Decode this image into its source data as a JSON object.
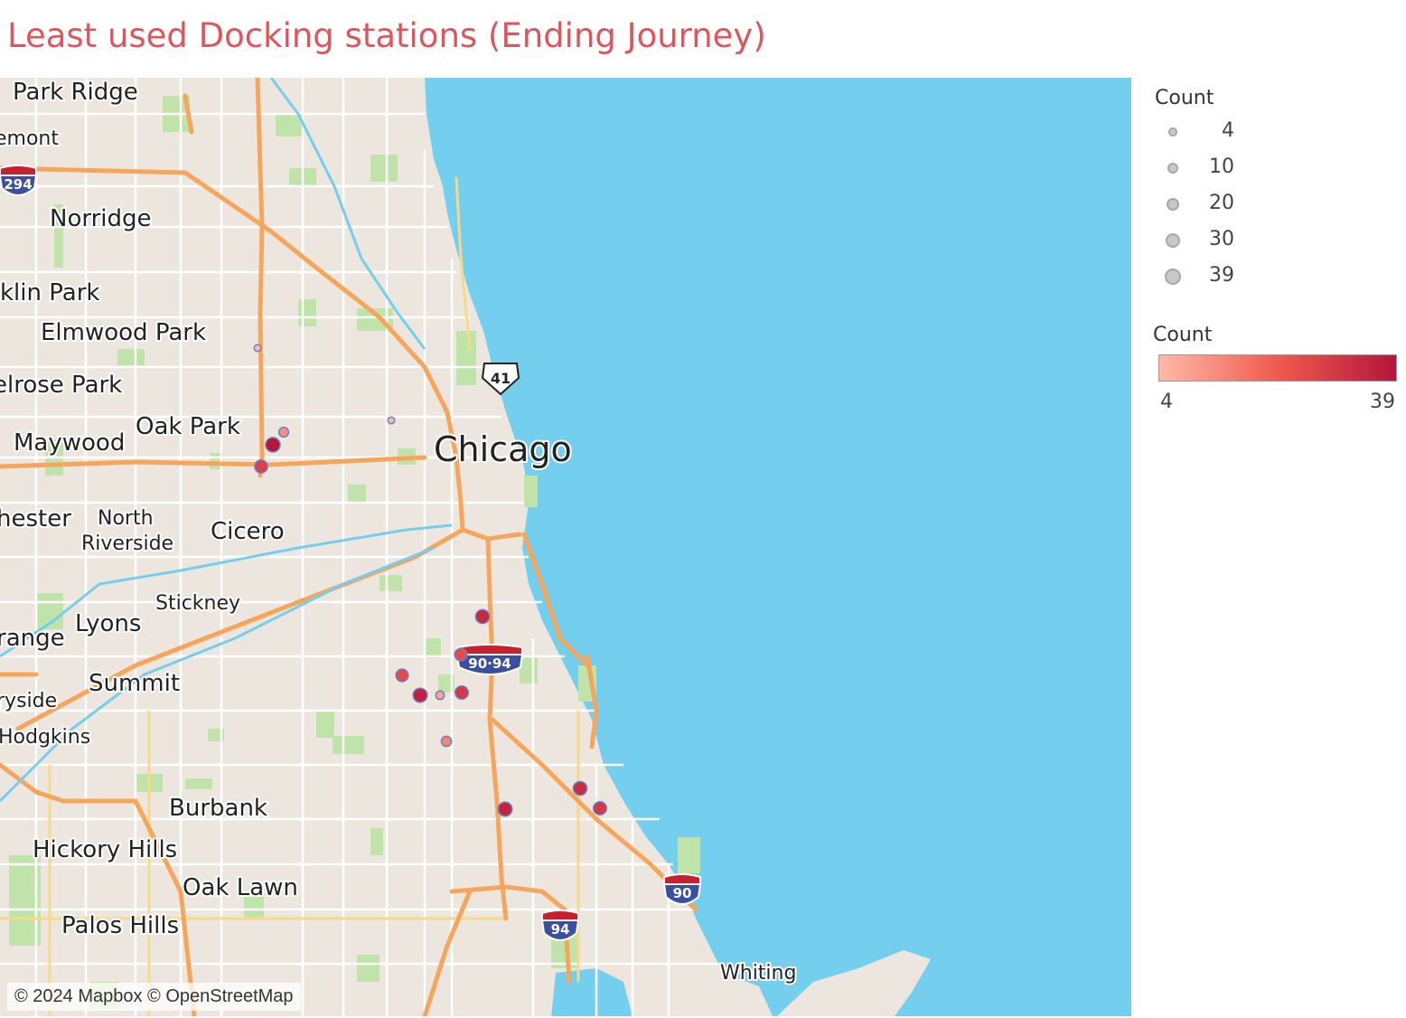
{
  "title": "Least used Docking stations (Ending Journey)",
  "attribution": "© 2024 Mapbox © OpenStreetMap",
  "colors": {
    "water": "#74cfee",
    "land": "#ede6df",
    "park": "#bfe3a9",
    "highway": "#f6a55d",
    "title": "#e0555c",
    "ramp_low": "#ffb9a8",
    "ramp_mid": "#f05a4e",
    "ramp_high": "#b5163d"
  },
  "places": [
    {
      "name": "Park Ridge"
    },
    {
      "name": "emont"
    },
    {
      "name": "Norridge"
    },
    {
      "name": "klin Park"
    },
    {
      "name": "Elmwood Park"
    },
    {
      "name": "elrose Park"
    },
    {
      "name": "Oak Park"
    },
    {
      "name": "Maywood"
    },
    {
      "name": "Chicago"
    },
    {
      "name": "hester"
    },
    {
      "name": "North"
    },
    {
      "name": "Riverside"
    },
    {
      "name": "Cicero"
    },
    {
      "name": "Stickney"
    },
    {
      "name": "Lyons"
    },
    {
      "name": "range"
    },
    {
      "name": "Summit"
    },
    {
      "name": "ryside"
    },
    {
      "name": "Hodgkins"
    },
    {
      "name": "Burbank"
    },
    {
      "name": "Hickory Hills"
    },
    {
      "name": "Oak Lawn"
    },
    {
      "name": "Palos Hills"
    },
    {
      "name": "Whiting"
    }
  ],
  "shields": [
    {
      "label": "294",
      "type": "interstate"
    },
    {
      "label": "41",
      "type": "us"
    },
    {
      "label": "90·94",
      "type": "interstate"
    },
    {
      "label": "90",
      "type": "interstate"
    },
    {
      "label": "94",
      "type": "interstate"
    }
  ],
  "stations": [
    {
      "count": 4
    },
    {
      "count": 4
    },
    {
      "count": 12
    },
    {
      "count": 39
    },
    {
      "count": 28
    },
    {
      "count": 34
    },
    {
      "count": 25
    },
    {
      "count": 25
    },
    {
      "count": 36
    },
    {
      "count": 8
    },
    {
      "count": 30
    },
    {
      "count": 14
    },
    {
      "count": 35
    },
    {
      "count": 33
    },
    {
      "count": 30
    }
  ],
  "legend": {
    "size_title": "Count",
    "size_items": [
      {
        "label": "4",
        "value": 4
      },
      {
        "label": "10",
        "value": 10
      },
      {
        "label": "20",
        "value": 20
      },
      {
        "label": "30",
        "value": 30
      },
      {
        "label": "39",
        "value": 39
      }
    ],
    "color_title": "Count",
    "color_min": "4",
    "color_max": "39"
  }
}
